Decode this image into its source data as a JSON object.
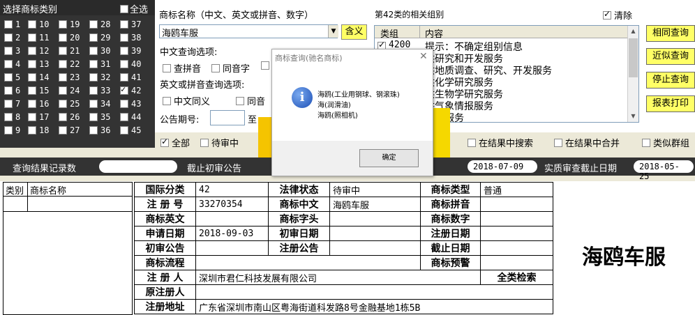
{
  "categories": {
    "title": "选择商标类别",
    "select_all": "全选",
    "items": [
      {
        "n": "1",
        "checked": false
      },
      {
        "n": "10",
        "checked": false
      },
      {
        "n": "19",
        "checked": false
      },
      {
        "n": "28",
        "checked": false
      },
      {
        "n": "37",
        "checked": false
      },
      {
        "n": "2",
        "checked": false
      },
      {
        "n": "11",
        "checked": false
      },
      {
        "n": "20",
        "checked": false
      },
      {
        "n": "29",
        "checked": false
      },
      {
        "n": "38",
        "checked": false
      },
      {
        "n": "3",
        "checked": false
      },
      {
        "n": "12",
        "checked": false
      },
      {
        "n": "21",
        "checked": false
      },
      {
        "n": "30",
        "checked": false
      },
      {
        "n": "39",
        "checked": false
      },
      {
        "n": "4",
        "checked": false
      },
      {
        "n": "13",
        "checked": false
      },
      {
        "n": "22",
        "checked": false
      },
      {
        "n": "31",
        "checked": false
      },
      {
        "n": "40",
        "checked": false
      },
      {
        "n": "5",
        "checked": false
      },
      {
        "n": "14",
        "checked": false
      },
      {
        "n": "23",
        "checked": false
      },
      {
        "n": "32",
        "checked": false
      },
      {
        "n": "41",
        "checked": false
      },
      {
        "n": "6",
        "checked": false
      },
      {
        "n": "15",
        "checked": false
      },
      {
        "n": "24",
        "checked": false
      },
      {
        "n": "33",
        "checked": false
      },
      {
        "n": "42",
        "checked": true
      },
      {
        "n": "7",
        "checked": false
      },
      {
        "n": "16",
        "checked": false
      },
      {
        "n": "25",
        "checked": false
      },
      {
        "n": "34",
        "checked": false
      },
      {
        "n": "43",
        "checked": false
      },
      {
        "n": "8",
        "checked": false
      },
      {
        "n": "17",
        "checked": false
      },
      {
        "n": "26",
        "checked": false
      },
      {
        "n": "35",
        "checked": false
      },
      {
        "n": "44",
        "checked": false
      },
      {
        "n": "9",
        "checked": false
      },
      {
        "n": "18",
        "checked": false
      },
      {
        "n": "27",
        "checked": false
      },
      {
        "n": "36",
        "checked": false
      },
      {
        "n": "45",
        "checked": false
      }
    ]
  },
  "search": {
    "name_label": "商标名称（中文、英文或拼音、数字）",
    "name_value": "海鸥车服",
    "meaning_button": "含义",
    "chinese_options_label": "中文查询选项:",
    "chinese_options": [
      "查拼音",
      "同音字"
    ],
    "english_options_label": "英文或拼音查询选项:",
    "english_options": [
      "中文同义",
      "同音"
    ],
    "period_label": "公告期号:",
    "period_to": "至"
  },
  "groups": {
    "title": "第42类的相关组别",
    "clear_label": "清除",
    "clear_checked": true,
    "col_group": "类组",
    "col_content": "内容",
    "rows": [
      {
        "code": "4200",
        "text": "提示：不确定组别信息",
        "checked": true
      },
      {
        "code": "",
        "text": "供研究和开发服务",
        "checked": false
      },
      {
        "code": "",
        "text": "供地质调查、研究、开发服务",
        "checked": false
      },
      {
        "code": "",
        "text": "供化学研究服务",
        "checked": false
      },
      {
        "code": "",
        "text": "供生物学研究服务",
        "checked": false
      },
      {
        "code": "",
        "text": "供气象情报服务",
        "checked": false
      },
      {
        "code": "",
        "text": "测试服务",
        "checked": false
      }
    ]
  },
  "side_buttons": {
    "same": "相同查询",
    "similar": "近似查询",
    "stop": "停止查询",
    "print": "报表打印"
  },
  "filters": {
    "all": "全部",
    "pending": "待审中",
    "search_in_results": "在结果中搜索",
    "merge_in_results": "在结果中合并",
    "similar_groups": "类似群组"
  },
  "dialog": {
    "title": "商标查询(驰名商标)",
    "lines": [
      "海鸥(工业用钢球、钢滚珠)",
      "海(润滑油)",
      "海鸥(照相机)"
    ],
    "ok": "确定"
  },
  "bar": {
    "records_label": "查询结果记录数",
    "records_value": "",
    "prelim_deadline_label": "截止初审公告",
    "prelim_date": "2018-07-09",
    "substantive_label": "实质审查截止日期",
    "substantive_date": "2018-05-25"
  },
  "result_list": {
    "col_category": "类别",
    "col_name": "商标名称"
  },
  "detail": {
    "intl_class_label": "国际分类",
    "intl_class": "42",
    "legal_status_label": "法律状态",
    "legal_status": "待审中",
    "type_label": "商标类型",
    "type": "普通",
    "reg_no_label": "注 册 号",
    "reg_no": "33270354",
    "chinese_label": "商标中文",
    "chinese": "海鸥车服",
    "pinyin_label": "商标拼音",
    "pinyin": "",
    "english_label": "商标英文",
    "english": "",
    "initial_label": "商标字头",
    "initial": "",
    "digits_label": "商标数字",
    "digits": "",
    "apply_date_label": "申请日期",
    "apply_date": "2018-09-03",
    "prelim_date_label": "初审日期",
    "prelim_date": "",
    "reg_date_label": "注册日期",
    "reg_date": "",
    "prelim_notice_label": "初审公告",
    "prelim_notice": "",
    "reg_notice_label": "注册公告",
    "reg_notice": "",
    "deadline_label": "截止日期",
    "deadline": "",
    "flow_label": "商标流程",
    "flow": "",
    "warning_label": "商标预警",
    "warning": "",
    "registrant_label": "注 册 人",
    "registrant": "深圳市君仁科技发展有限公司",
    "all_class_search": "全类检索",
    "orig_registrant_label": "原注册人",
    "orig_registrant": "",
    "address_label": "注册地址",
    "address": "广东省深圳市南山区粤海街道科发路8号金融基地1栋5B",
    "display_name": "海鸥车服"
  }
}
